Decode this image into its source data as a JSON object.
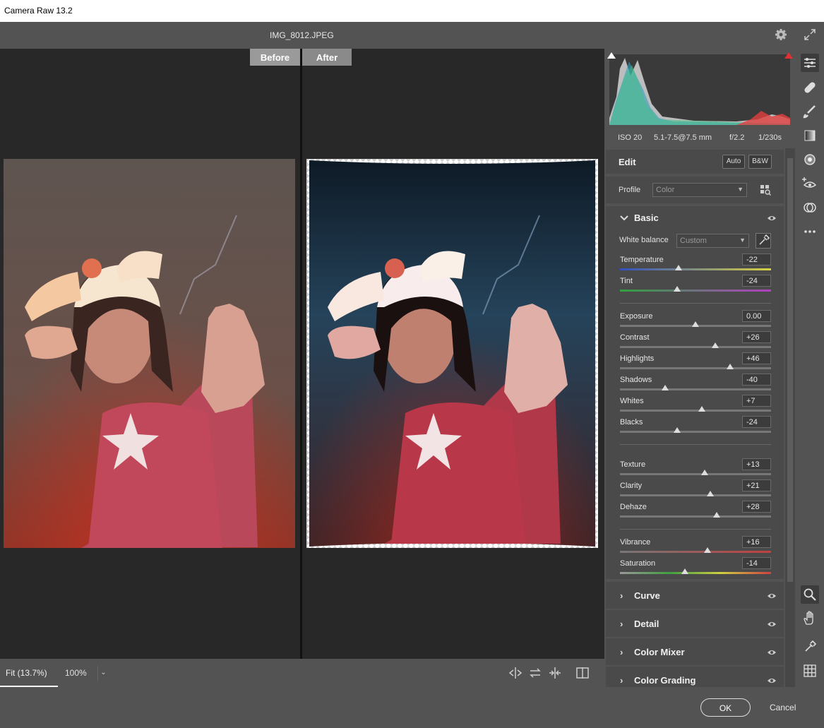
{
  "app": {
    "title": "Camera Raw 13.2",
    "filename": "IMG_8012.JPEG"
  },
  "compare": {
    "before_label": "Before",
    "after_label": "After"
  },
  "bottom": {
    "fit_label": "Fit (13.7%)",
    "zoom_label": "100%",
    "dropdown_glyph": "⌄"
  },
  "footer": {
    "ok_label": "OK",
    "cancel_label": "Cancel"
  },
  "meta": {
    "iso": "ISO 20",
    "lens": "5.1-7.5@7.5 mm",
    "aperture": "f/2.2",
    "shutter": "1/230s"
  },
  "edit": {
    "title": "Edit",
    "auto_label": "Auto",
    "bw_label": "B&W"
  },
  "profile": {
    "label": "Profile",
    "value": "Color"
  },
  "basic": {
    "title": "Basic",
    "white_balance_label": "White balance",
    "white_balance_value": "Custom",
    "sliders": [
      {
        "label": "Temperature",
        "value": "-22",
        "position": 0.39
      },
      {
        "label": "Tint",
        "value": "-24",
        "position": 0.38
      },
      {
        "label": "Exposure",
        "value": "0.00",
        "position": 0.5
      },
      {
        "label": "Contrast",
        "value": "+26",
        "position": 0.63
      },
      {
        "label": "Highlights",
        "value": "+46",
        "position": 0.73
      },
      {
        "label": "Shadows",
        "value": "-40",
        "position": 0.3
      },
      {
        "label": "Whites",
        "value": "+7",
        "position": 0.54
      },
      {
        "label": "Blacks",
        "value": "-24",
        "position": 0.38
      },
      {
        "label": "Texture",
        "value": "+13",
        "position": 0.56
      },
      {
        "label": "Clarity",
        "value": "+21",
        "position": 0.6
      },
      {
        "label": "Dehaze",
        "value": "+28",
        "position": 0.64
      },
      {
        "label": "Vibrance",
        "value": "+16",
        "position": 0.58
      },
      {
        "label": "Saturation",
        "value": "-14",
        "position": 0.43
      }
    ]
  },
  "sections": [
    {
      "name": "Curve"
    },
    {
      "name": "Detail"
    },
    {
      "name": "Color Mixer"
    },
    {
      "name": "Color Grading"
    }
  ],
  "toolbar_icons": [
    "edit-sliders-icon",
    "healing-icon",
    "brush-icon",
    "linear-gradient-icon",
    "radial-filter-icon",
    "red-eye-icon",
    "presets-icon",
    "more-icon",
    "zoom-icon",
    "hand-icon",
    "color-sampler-icon",
    "grid-icon"
  ],
  "colors": {
    "panel": "#535353",
    "canvas": "#282828",
    "accent": "#ffffff"
  }
}
